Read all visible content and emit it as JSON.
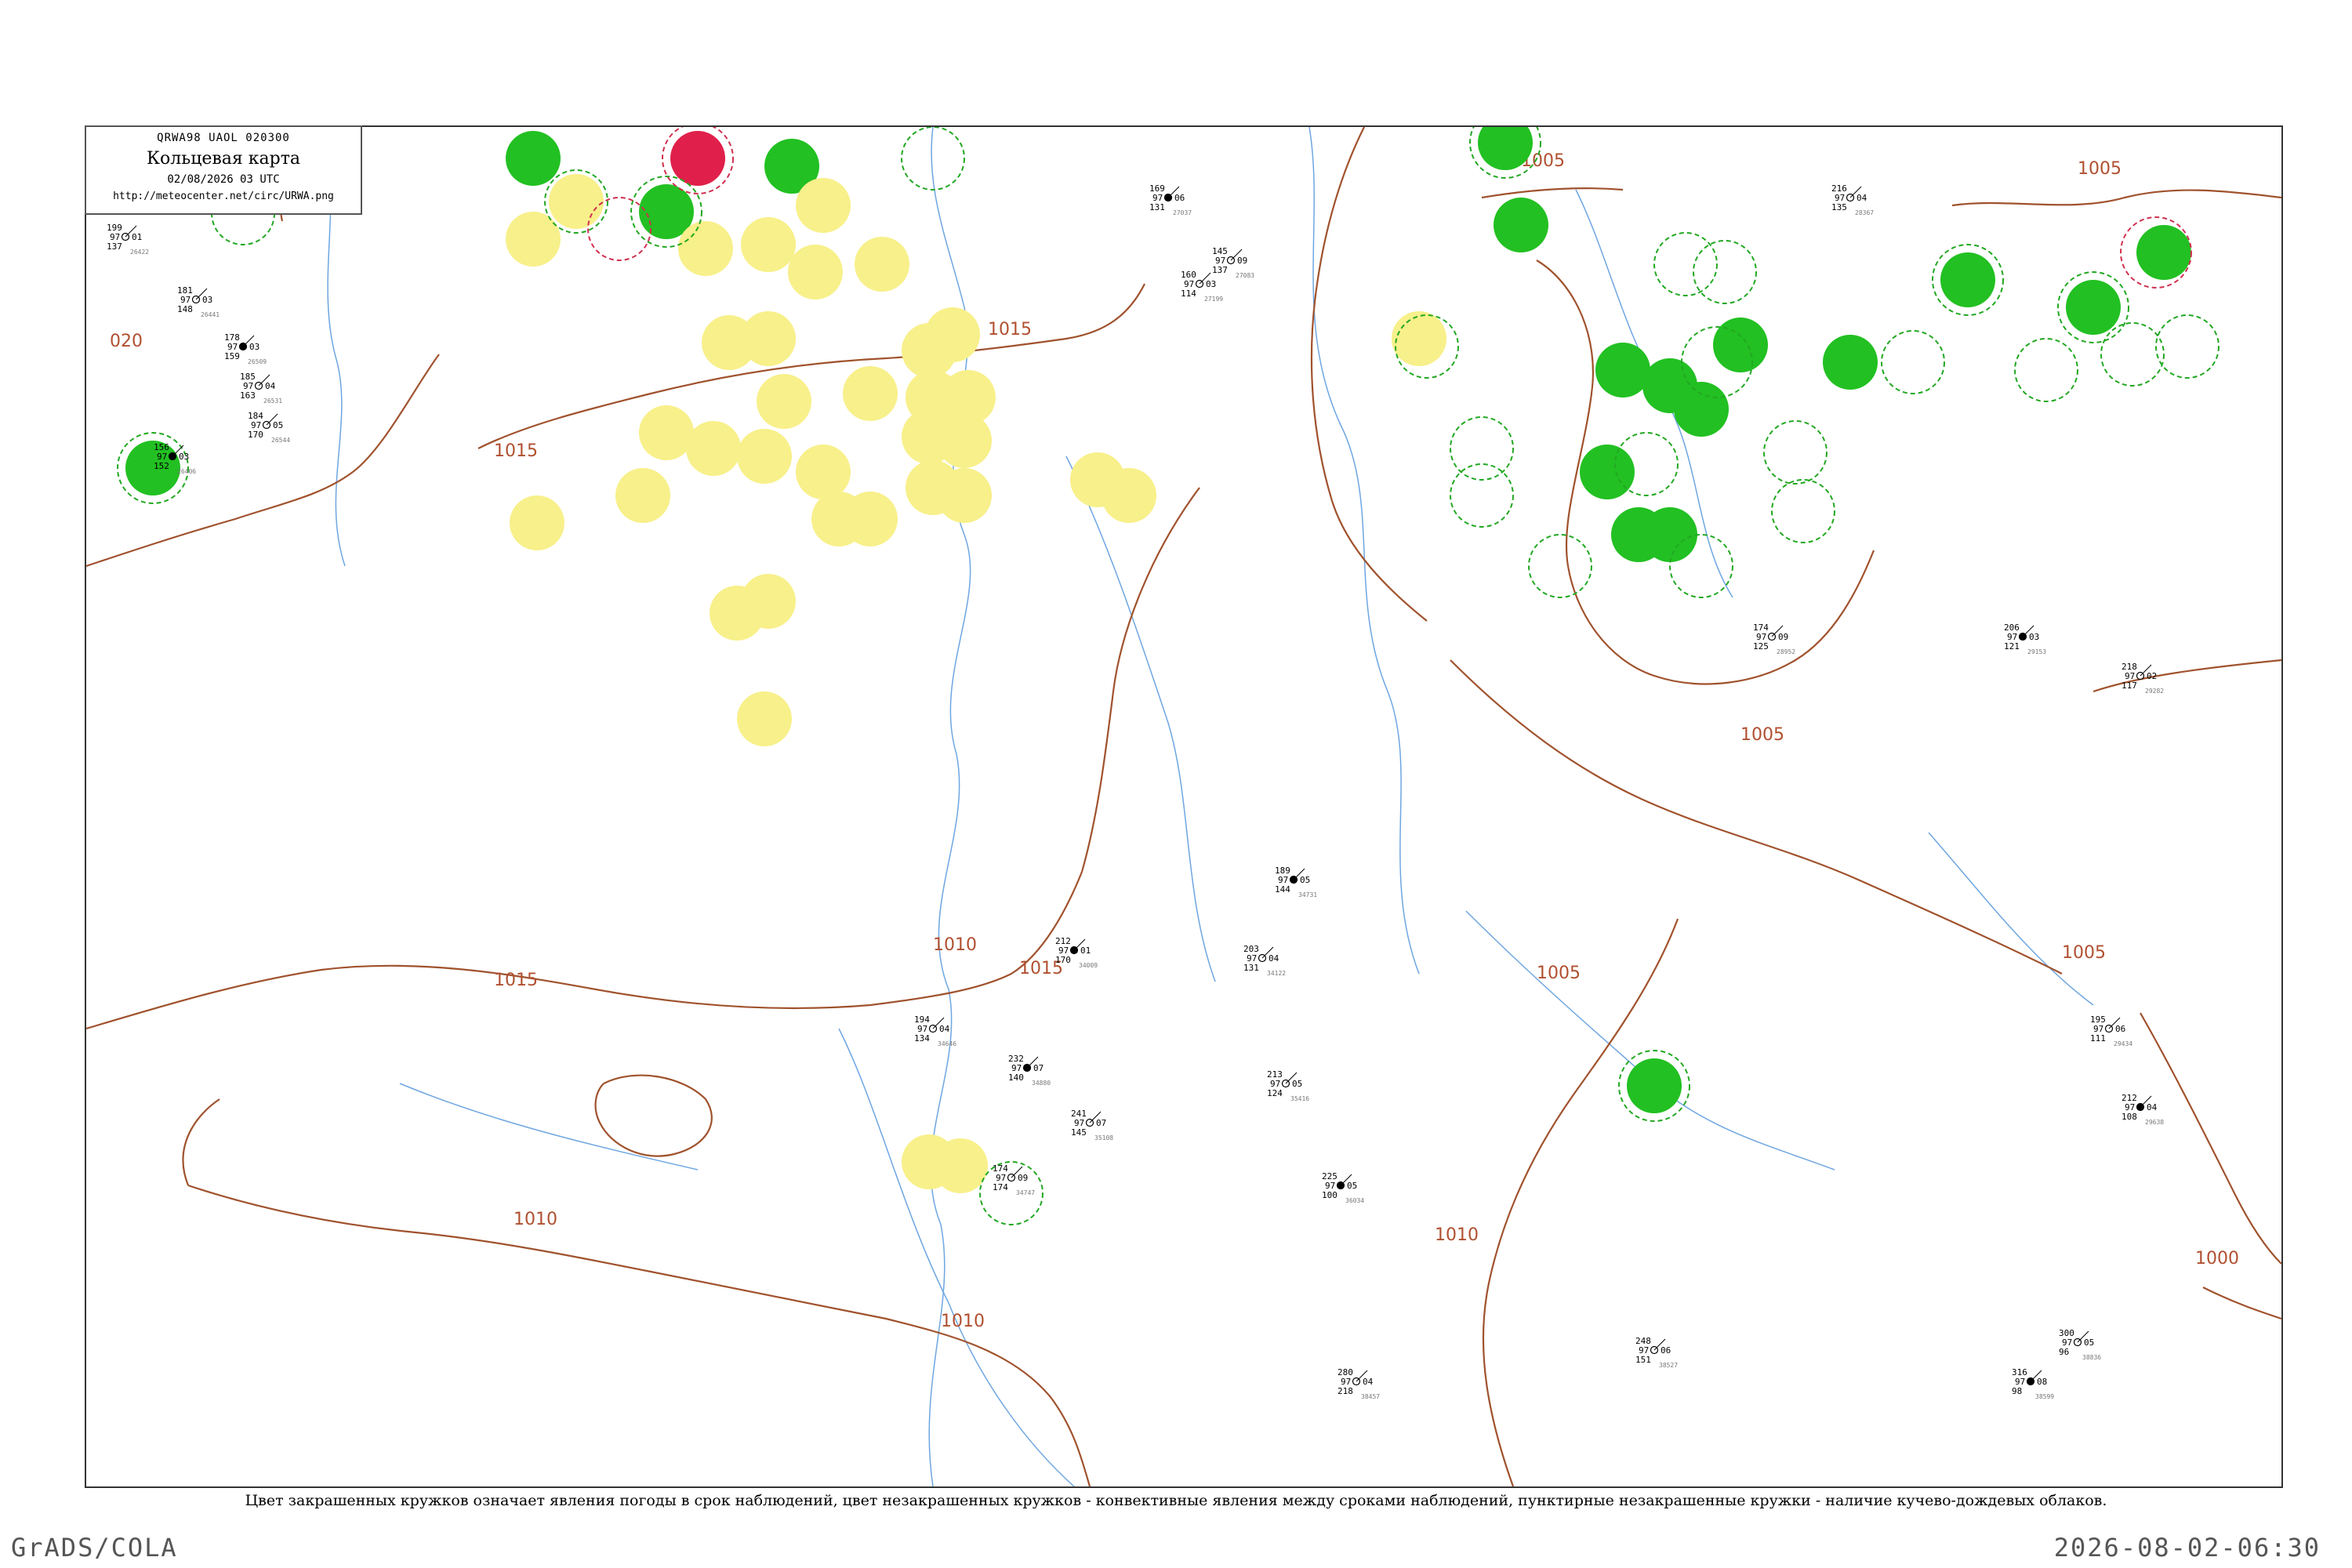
{
  "header": {
    "code_line": "QRWA98  UAOL  020300",
    "title": "Кольцевая карта",
    "datetime": "02/08/2026 03 UTC",
    "url": "http://meteocenter.net/circ/URWA.png"
  },
  "caption": "Цвет закрашенных кружков означает явления погоды в срок наблюдений, цвет незакрашенных кружков - конвективные явления между сроками наблюдений, пунктирные незакрашенные кружки - наличие кучево-дождевых облаков.",
  "footer": {
    "left": "GrADS/COLA",
    "right": "2026-08-02-06:30"
  },
  "colors": {
    "isobar": "#a0522d",
    "isobar_label": "#b05030",
    "river": "#4a90d9",
    "green_fill": "#22c022",
    "yellow_fill": "#f8f08a",
    "red_fill": "#e0204a",
    "dashed_green": "#22a822",
    "dashed_red": "#d03050"
  },
  "isobar_labels": [
    "020",
    "1015",
    "1015",
    "1015",
    "1015",
    "1010",
    "1010",
    "1010",
    "1010",
    "1005",
    "1005",
    "1005",
    "1005",
    "1005",
    "1000"
  ],
  "stations": [
    {
      "top": "156",
      "l1": "97",
      "r1": "03",
      "bottom": "152",
      "num": "26406"
    },
    {
      "top": "199",
      "l1": "97",
      "r1": "01",
      "bottom": "137",
      "num": "26422"
    },
    {
      "top": "181",
      "l1": "97",
      "r1": "03",
      "bottom": "148",
      "num": "26441"
    },
    {
      "top": "178",
      "l1": "97",
      "r1": "03",
      "bottom": "159",
      "num": "26509"
    },
    {
      "top": "185",
      "l1": "97",
      "r1": "04",
      "bottom": "163",
      "num": "26531"
    },
    {
      "top": "184",
      "l1": "97",
      "r1": "05",
      "bottom": "170",
      "num": "26544"
    },
    {
      "top": "169",
      "l1": "97",
      "r1": "06",
      "bottom": "131",
      "num": "27037"
    },
    {
      "top": "145",
      "l1": "97",
      "r1": "09",
      "bottom": "137",
      "num": "27083"
    },
    {
      "top": "160",
      "l1": "97",
      "r1": "03",
      "bottom": "114",
      "num": "27199"
    },
    {
      "top": "212",
      "l1": "97",
      "r1": "01",
      "bottom": "170",
      "num": "34009"
    },
    {
      "top": "203",
      "l1": "97",
      "r1": "04",
      "bottom": "131",
      "num": "34122"
    },
    {
      "top": "194",
      "l1": "97",
      "r1": "04",
      "bottom": "134",
      "num": "34646"
    },
    {
      "top": "232",
      "l1": "97",
      "r1": "07",
      "bottom": "140",
      "num": "34880"
    },
    {
      "top": "241",
      "l1": "97",
      "r1": "07",
      "bottom": "145",
      "num": "35108"
    },
    {
      "top": "213",
      "l1": "97",
      "r1": "05",
      "bottom": "124",
      "num": "35416"
    },
    {
      "top": "225",
      "l1": "97",
      "r1": "05",
      "bottom": "100",
      "num": "36034"
    },
    {
      "top": "216",
      "l1": "97",
      "r1": "04",
      "bottom": "135",
      "num": "28367"
    },
    {
      "top": "174",
      "l1": "97",
      "r1": "09",
      "bottom": "125",
      "num": "28952"
    },
    {
      "top": "206",
      "l1": "97",
      "r1": "03",
      "bottom": "121",
      "num": "29153"
    },
    {
      "top": "218",
      "l1": "97",
      "r1": "02",
      "bottom": "117",
      "num": "29282"
    },
    {
      "top": "195",
      "l1": "97",
      "r1": "06",
      "bottom": "111",
      "num": "29434"
    },
    {
      "top": "212",
      "l1": "97",
      "r1": "04",
      "bottom": "108",
      "num": "29638"
    },
    {
      "top": "280",
      "l1": "97",
      "r1": "04",
      "bottom": "218",
      "num": "38457"
    },
    {
      "top": "248",
      "l1": "97",
      "r1": "06",
      "bottom": "151",
      "num": "38527"
    },
    {
      "top": "316",
      "l1": "97",
      "r1": "08",
      "bottom": "98",
      "num": "38599"
    },
    {
      "top": "300",
      "l1": "97",
      "r1": "05",
      "bottom": "96",
      "num": "38836"
    },
    {
      "top": "174",
      "l1": "97",
      "r1": "09",
      "bottom": "174",
      "num": "34747"
    },
    {
      "top": "189",
      "l1": "97",
      "r1": "05",
      "bottom": "144",
      "num": "34731"
    }
  ]
}
